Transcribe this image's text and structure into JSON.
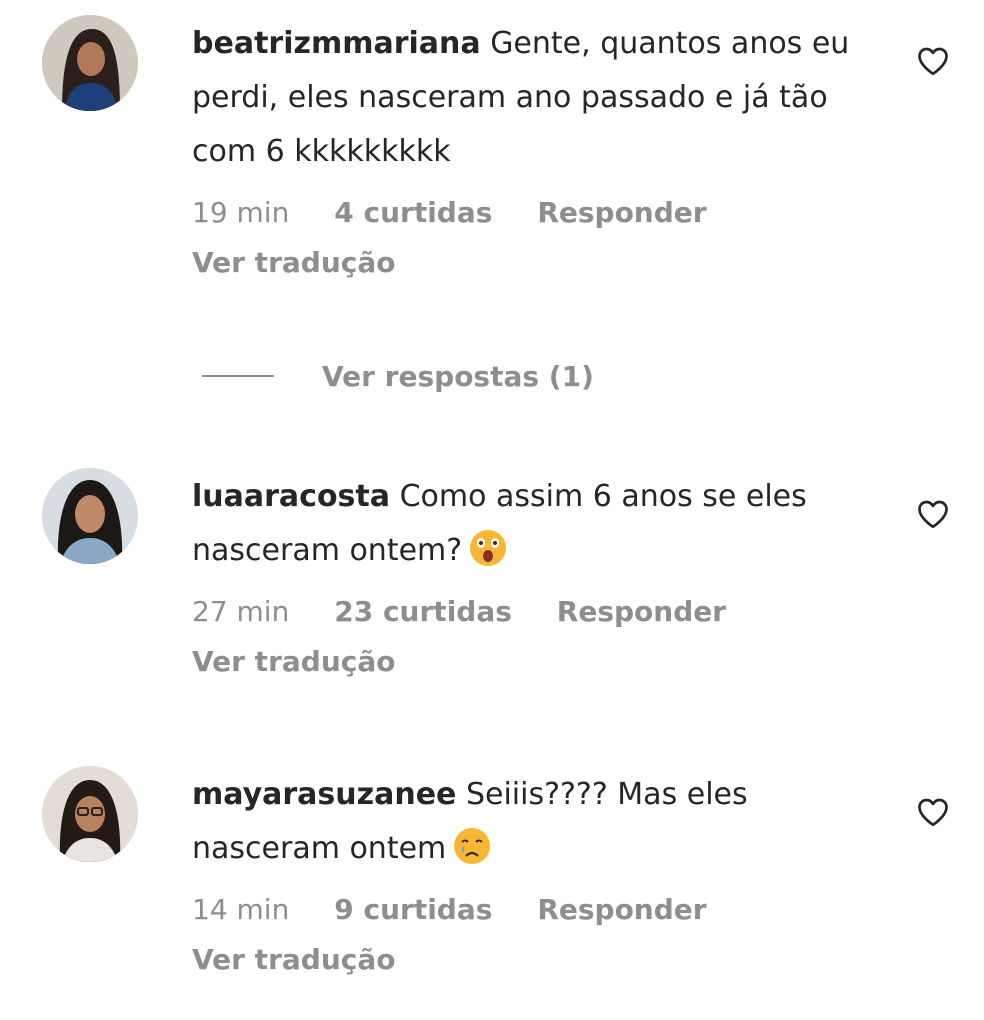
{
  "comments": [
    {
      "username": "beatrizmmariana",
      "text": "Gente, quantos anos eu perdi, eles nasceram ano passado e já tão com 6 kkkkkkkkk",
      "time": "19 min",
      "likes": "4 curtidas",
      "reply": "Responder",
      "translate": "Ver tradução",
      "view_replies": "Ver respostas (1)"
    },
    {
      "username": "luaaracosta",
      "text": "Como assim 6 anos se eles nasceram ontem?",
      "emoji": "astonished-face-emoji",
      "time": "27 min",
      "likes": "23 curtidas",
      "reply": "Responder",
      "translate": "Ver tradução"
    },
    {
      "username": "mayarasuzanee",
      "text": "Seiiis???? Mas eles nasceram ontem",
      "emoji": "crying-face-emoji",
      "time": "14 min",
      "likes": "9 curtidas",
      "reply": "Responder",
      "translate": "Ver tradução"
    }
  ],
  "icons": {
    "like": "heart-outline-icon"
  },
  "colors": {
    "primary_text": "#262626",
    "secondary_text": "#8e8e8e",
    "background": "#ffffff"
  }
}
